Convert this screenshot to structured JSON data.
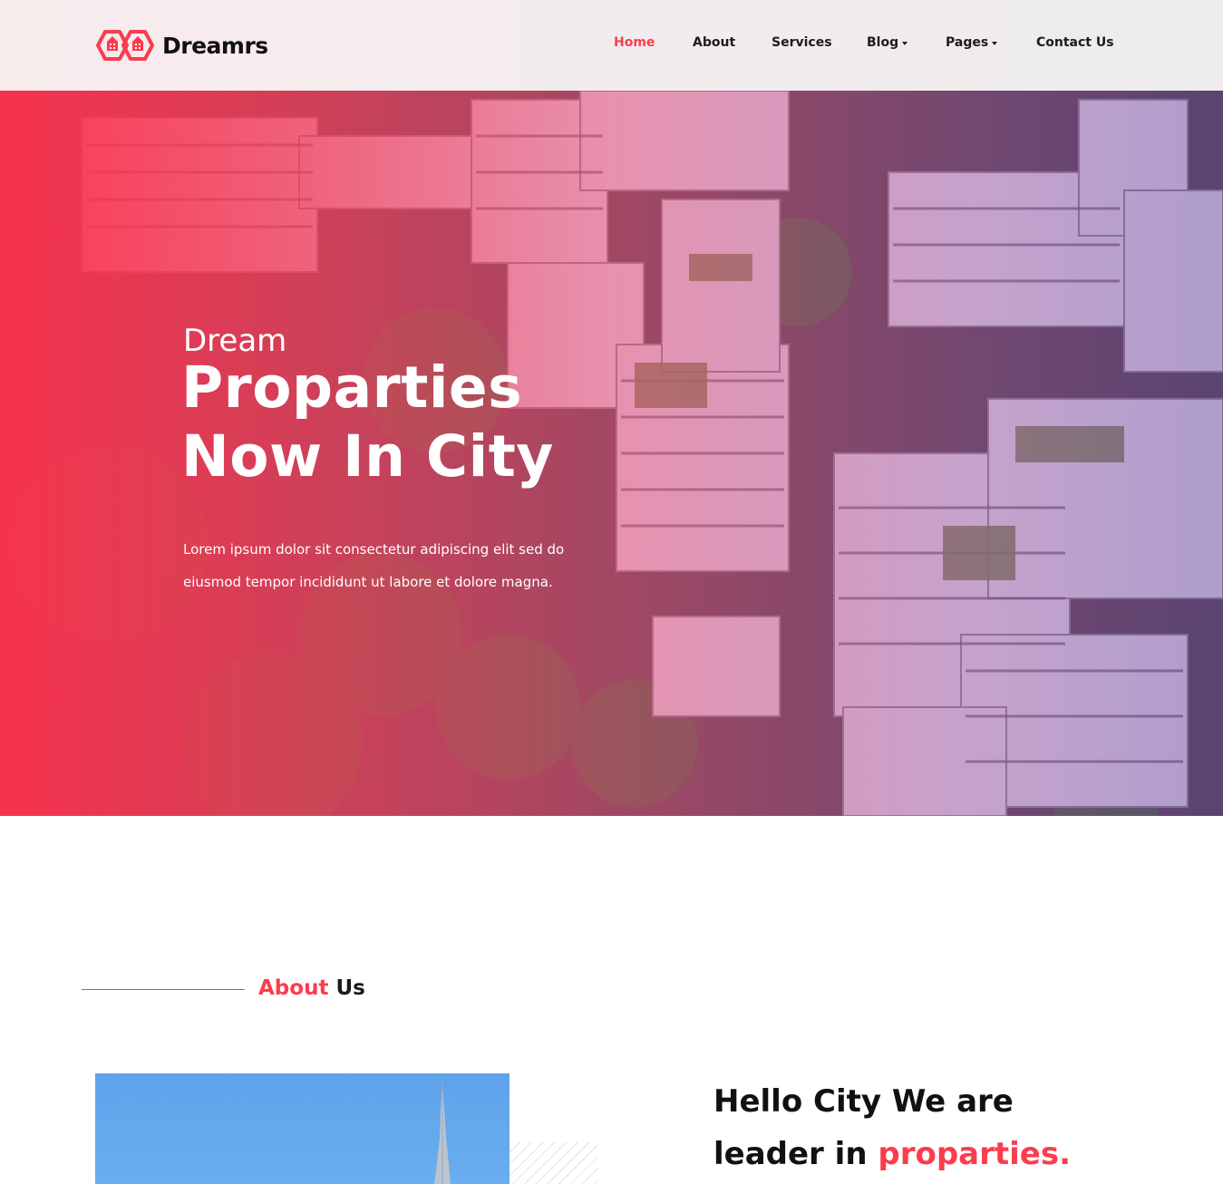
{
  "brand": {
    "name": "Dreamrs",
    "accent_color": "#fc3c4d",
    "logo_icon": "twin-house-hexagon-icon"
  },
  "nav": {
    "items": [
      {
        "label": "Home",
        "active": true,
        "dropdown": false
      },
      {
        "label": "About",
        "active": false,
        "dropdown": false
      },
      {
        "label": "Services",
        "active": false,
        "dropdown": false
      },
      {
        "label": "Blog",
        "active": false,
        "dropdown": true
      },
      {
        "label": "Pages",
        "active": false,
        "dropdown": true
      },
      {
        "label": "Contact Us",
        "active": false,
        "dropdown": false
      }
    ]
  },
  "hero": {
    "subtitle": "Dream",
    "title_line1": "Proparties",
    "title_line2": "Now In City",
    "description_line1": "Lorem ipsum dolor sit consectetur adipiscing elit sed do",
    "description_line2": "eiusmod tempor incididunt ut labore et dolore magna.",
    "background": "aerial-city-buildings-photo"
  },
  "about": {
    "heading_accent": "About",
    "heading_rest": "Us",
    "title_line1": "Hello City We are",
    "title_line2_plain": "leader in ",
    "title_line2_accent": "proparties.",
    "image": "tower-skyline-photo"
  }
}
